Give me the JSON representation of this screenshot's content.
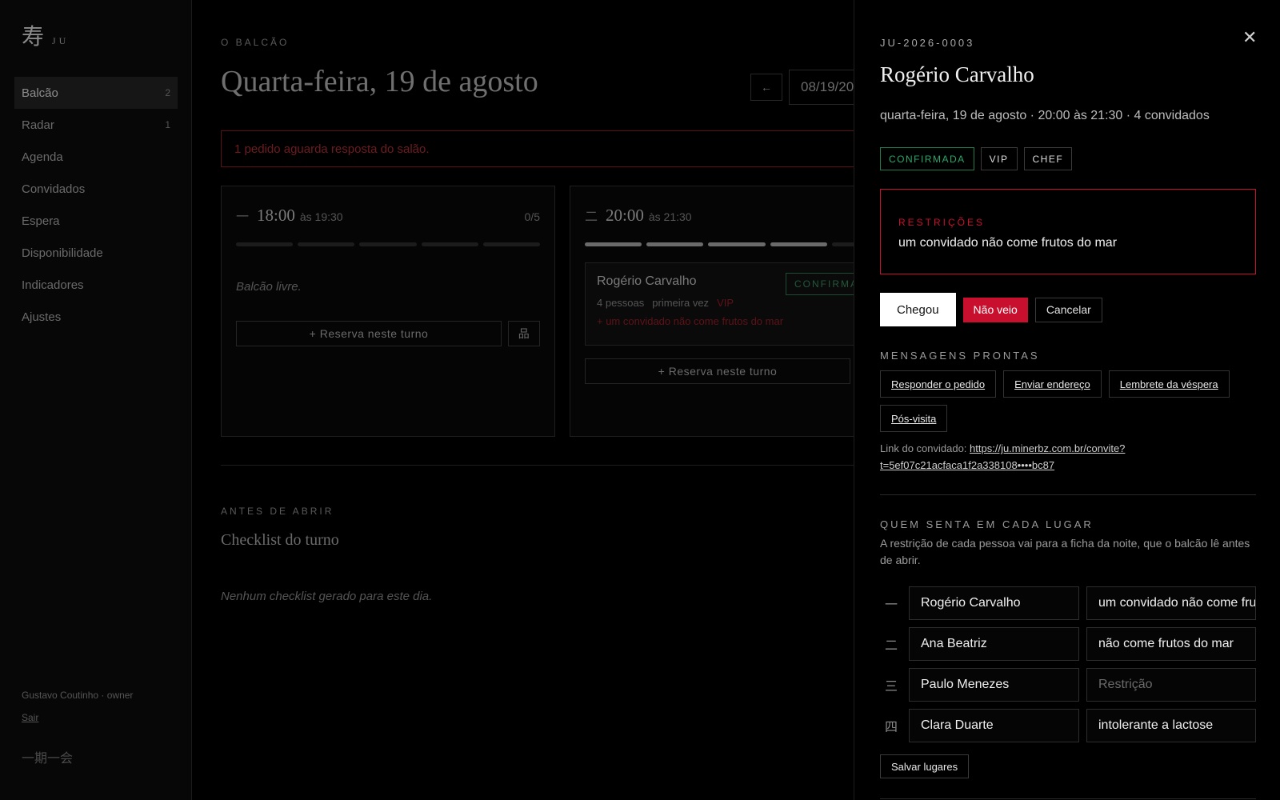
{
  "sidebar": {
    "logo_glyph": "寿",
    "logo_text": "JU",
    "items": [
      {
        "label": "Balcão",
        "count": "2"
      },
      {
        "label": "Radar",
        "count": "1"
      },
      {
        "label": "Agenda",
        "count": ""
      },
      {
        "label": "Convidados",
        "count": ""
      },
      {
        "label": "Espera",
        "count": ""
      },
      {
        "label": "Disponibilidade",
        "count": ""
      },
      {
        "label": "Indicadores",
        "count": ""
      },
      {
        "label": "Ajustes",
        "count": ""
      }
    ],
    "user_line": "Gustavo Coutinho · owner",
    "logout_label": "Sair",
    "motto": "一期一会"
  },
  "main": {
    "eyebrow": "O BALCÃO",
    "title": "Quarta-feira, 19 de agosto",
    "prev_icon": "←",
    "date_value": "08/19/20",
    "alert": "1 pedido aguarda resposta do salão.",
    "shifts": [
      {
        "glyph": "一",
        "time": "18:00",
        "end": "às 19:30",
        "capacity": "0/5",
        "empty_note": "Balcão livre.",
        "add_label": "+ Reserva neste turno",
        "seat_icon": "品"
      },
      {
        "glyph": "二",
        "time": "20:00",
        "end": "às 21:30",
        "reservation": {
          "name": "Rogério Carvalho",
          "people": "4 pessoas",
          "first": "primeira vez",
          "vip": "VIP",
          "restriction": "+ um convidado não come frutos do mar",
          "status": "CONFIRMAD"
        },
        "add_label": "+ Reserva neste turno"
      }
    ],
    "before_eyebrow": "ANTES DE ABRIR",
    "checklist_title": "Checklist do turno",
    "checklist_empty": "Nenhum checklist gerado para este dia."
  },
  "drawer": {
    "code": "JU-2026-0003",
    "close_icon": "✕",
    "name": "Rogério Carvalho",
    "when": "quarta-feira, 19 de agosto · 20:00 às 21:30 · 4 convidados",
    "tags": {
      "status": "CONFIRMADA",
      "vip": "VIP",
      "chef": "CHEF"
    },
    "restrictions_label": "RESTRIÇÕES",
    "restrictions_text": "um convidado não come frutos do mar",
    "buttons": {
      "arrived": "Chegou",
      "no_show": "Não veio",
      "cancel": "Cancelar"
    },
    "messages_label": "MENSAGENS PRONTAS",
    "messages": [
      "Responder o pedido",
      "Enviar endereço",
      "Lembrete da véspera",
      "Pós-visita"
    ],
    "link_label": "Link do convidado:",
    "link_url": "https://ju.minerbz.com.br/convite?t=5ef07c21acfaca1f2a338108••••bc87",
    "seats_label": "QUEM SENTA EM CADA LUGAR",
    "seats_help": "A restrição de cada pessoa vai para a ficha da noite, que o balcão lê antes de abrir.",
    "restriction_placeholder": "Restrição",
    "seats": [
      {
        "num": "一",
        "name": "Rogério Carvalho",
        "restriction": "um convidado não come frutos do mar"
      },
      {
        "num": "二",
        "name": "Ana Beatriz",
        "restriction": "não come frutos do mar"
      },
      {
        "num": "三",
        "name": "Paulo Menezes",
        "restriction": ""
      },
      {
        "num": "四",
        "name": "Clara Duarte",
        "restriction": "intolerante a lactose"
      }
    ],
    "save_label": "Salvar lugares"
  }
}
